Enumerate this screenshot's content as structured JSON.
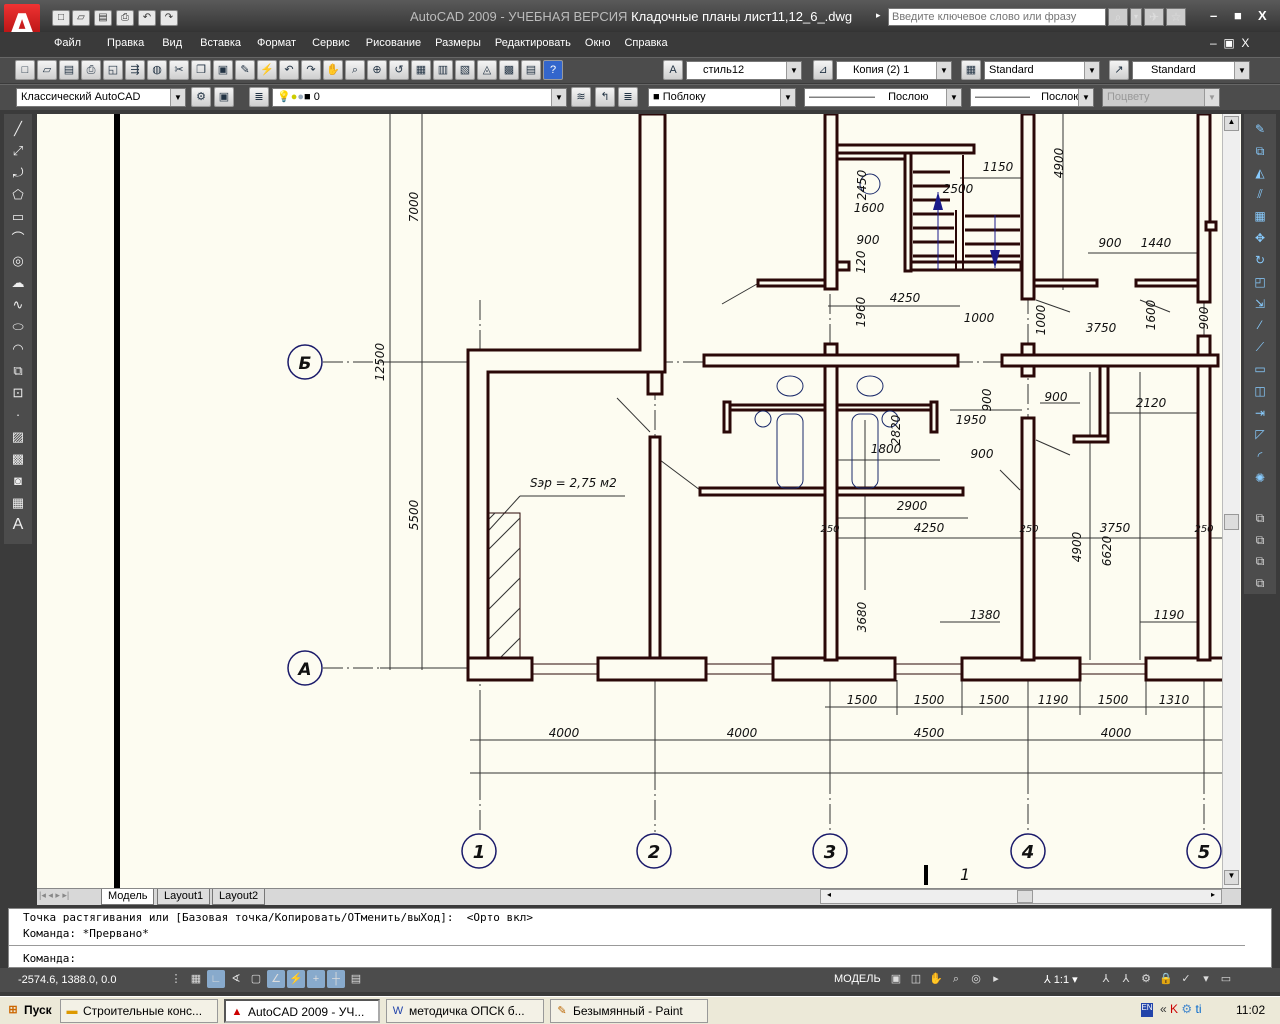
{
  "app": {
    "title_prefix": "AutoCAD 2009 - УЧЕБНАЯ ВЕРСИЯ",
    "document": "Кладочные планы лист11,12_6_.dwg",
    "search_placeholder": "Введите ключевое слово или фразу"
  },
  "menu": [
    "Файл",
    "Правка",
    "Вид",
    "Вставка",
    "Формат",
    "Сервис",
    "Рисование",
    "Размеры",
    "Редактировать",
    "Окно",
    "Справка"
  ],
  "toolbar": {
    "text_style": "стиль12",
    "dim_style": "Копия (2) 1",
    "table_style": "Standard",
    "mleader_style": "Standard",
    "workspace": "Классический AutoCAD",
    "layer": "0",
    "color": "Поблоку",
    "linetype": "Послою",
    "lineweight": "Послою",
    "plotstyle": "Поцвету"
  },
  "drawing": {
    "axes_numbers": [
      "1",
      "2",
      "3",
      "4",
      "5"
    ],
    "axes_letters": [
      "Б",
      "А"
    ],
    "area_label": "Sэр = 2,75 м2",
    "section_mark": "1",
    "dims": [
      "7000",
      "12500",
      "5500",
      "4000",
      "4000",
      "4500",
      "4000",
      "1500",
      "1500",
      "1500",
      "1190",
      "1500",
      "1310",
      "4250",
      "4250",
      "1150",
      "2500",
      "1600",
      "2450",
      "900",
      "120",
      "1960",
      "4900",
      "900",
      "1440",
      "1000",
      "1000",
      "3750",
      "1600",
      "900",
      "900",
      "1950",
      "900",
      "2120",
      "1800",
      "2820",
      "900",
      "2900",
      "3750",
      "4900",
      "6620",
      "3680",
      "1380",
      "1190",
      "250",
      "250",
      "250"
    ]
  },
  "tabs": [
    "Модель",
    "Layout1",
    "Layout2"
  ],
  "command": {
    "line1": "Точка растягивания или [Базовая точка/Копировать/ОТменить/выХод]:  <Орто вкл>",
    "line2": "Команда: *Прервано*",
    "prompt": "Команда:"
  },
  "status": {
    "coords": "-2574.6, 1388.0, 0.0",
    "model": "МОДЕЛЬ",
    "scale": "1:1"
  },
  "taskbar": {
    "start": "Пуск",
    "tasks": [
      "Строительные конс...",
      "AutoCAD 2009 - УЧ...",
      "методичка ОПСК б...",
      "Безымянный - Paint"
    ],
    "lang": "EN",
    "clock": "11:02"
  }
}
